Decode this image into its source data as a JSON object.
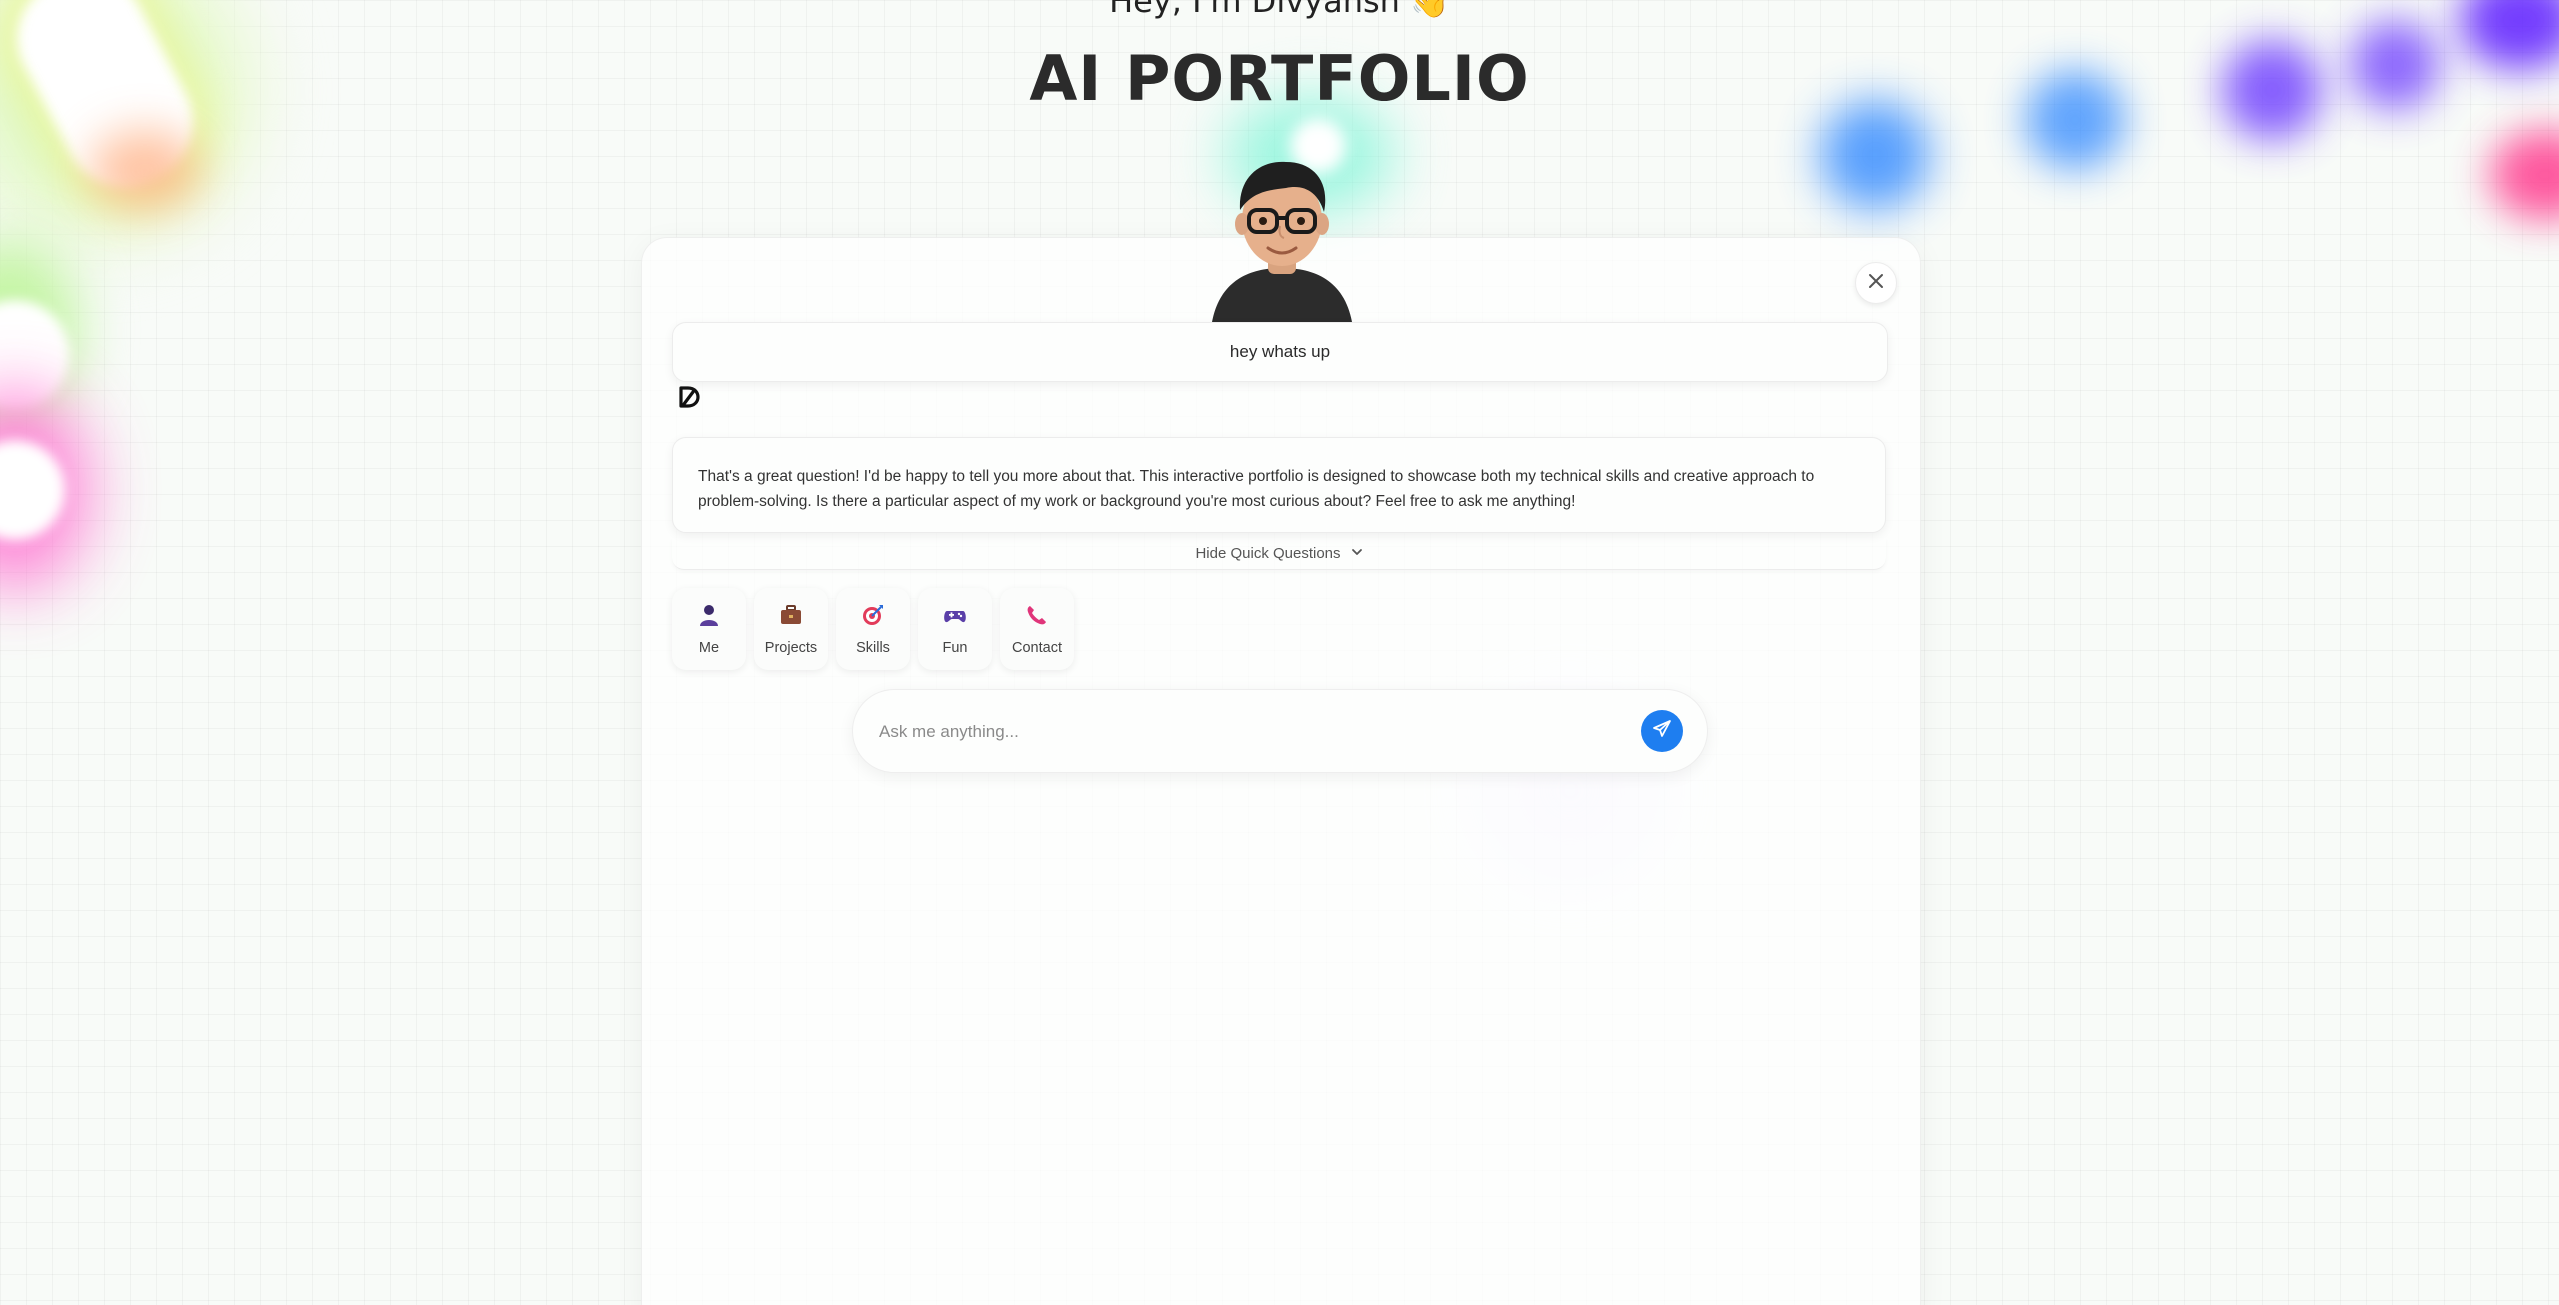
{
  "header": {
    "greeting": "Hey, I'm Divyansh 👋",
    "title": "AI PORTFOLIO"
  },
  "chat": {
    "user_message": "hey whats up",
    "bot_message": "That's a great question! I'd be happy to tell you more about that. This interactive portfolio is designed to showcase both my technical skills and creative approach to problem-solving. Is there a particular aspect of my work or background you're most curious about? Feel free to ask me anything!",
    "toggle_label": "Hide Quick Questions"
  },
  "quick_questions": [
    {
      "label": "Me",
      "icon": "person-icon"
    },
    {
      "label": "Projects",
      "icon": "briefcase-icon"
    },
    {
      "label": "Skills",
      "icon": "target-icon"
    },
    {
      "label": "Fun",
      "icon": "gamepad-icon"
    },
    {
      "label": "Contact",
      "icon": "phone-icon"
    }
  ],
  "input": {
    "placeholder": "Ask me anything..."
  },
  "colors": {
    "accent": "#1e7ef0",
    "title": "#2b2b2b"
  }
}
